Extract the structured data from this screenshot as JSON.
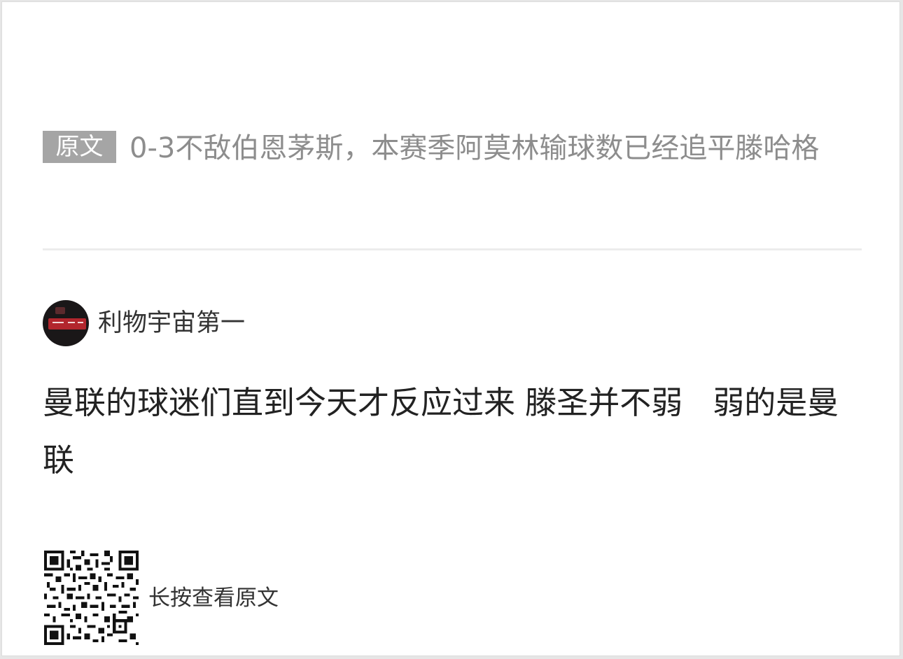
{
  "source": {
    "badge": "原文",
    "title": "0-3不敌伯恩茅斯，本赛季阿莫林输球数已经追平滕哈格"
  },
  "author": {
    "name": "利物宇宙第一"
  },
  "comment": {
    "text": "曼联的球迷们直到今天才反应过来 滕圣并不弱   弱的是曼联"
  },
  "footer": {
    "qr_label": "长按查看原文"
  }
}
